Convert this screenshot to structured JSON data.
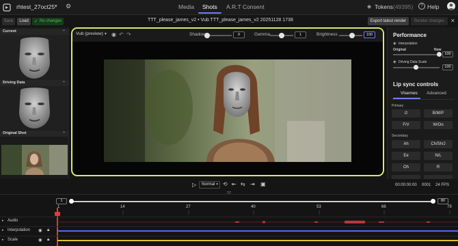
{
  "header": {
    "project_name": "rhtest_27oct25",
    "nav_tabs": [
      "Media",
      "Shots",
      "A.R.T Consent"
    ],
    "active_tab": "Shots",
    "tokens_label": "Tokens",
    "tokens_count": "(49395)",
    "help_label": "Help"
  },
  "toolbar": {
    "save_label": "Save",
    "load_label": "Load",
    "no_changes_label": "No changes",
    "shot_title": "TTT_please_james_v2 • Vub TTT_please_james_v2 20251128 1738",
    "export_label": "Export latest render",
    "render_changes_label": "Render changes"
  },
  "left_panel": {
    "sections": [
      "Current",
      "Driving Data",
      "Original Shot"
    ]
  },
  "viewer": {
    "preview_select": "Vub (preview)",
    "shadows_label": "Shadows",
    "shadows_value": "0",
    "gamma_label": "Gamma",
    "gamma_value": "1",
    "brightness_label": "Brightness",
    "brightness_value": "100",
    "shadows_level": 0.0,
    "gamma_level": 0.5,
    "brightness_level": 0.55
  },
  "performance": {
    "title": "Performance",
    "interpolation_label": "Interpolation",
    "original_label": "Original",
    "now_label": "Now",
    "interpolation_value": "100",
    "interpolation_level": 1.0,
    "driving_scale_label": "Driving Data Scale",
    "driving_scale_value": "100",
    "driving_scale_level": 0.5
  },
  "lip_sync": {
    "title": "Lip sync controls",
    "tabs": [
      "Visemes",
      "Advanced"
    ],
    "active_tab": "Visemes",
    "primary_label": "Primary",
    "primary_buttons": [
      "∅",
      "B/M/P",
      "F/V",
      "W/Oo"
    ],
    "secondary_label": "Secondary",
    "secondary_buttons": [
      "Ah",
      "Ch/Sh/J",
      "Ee",
      "N/L",
      "Oh",
      "R"
    ]
  },
  "transport": {
    "speed": "Normal",
    "timecode": "00:00:00:00",
    "frame": "0001",
    "fps": "24 FPS"
  },
  "timeline": {
    "range_start": "1",
    "range_end": "80",
    "ticks": [
      "1",
      "14",
      "27",
      "40",
      "53",
      "66",
      "79"
    ],
    "tracks": [
      "Audio",
      "Interpolation",
      "Scale"
    ]
  },
  "colors": {
    "accent": "#6f7cff",
    "viewer_border": "#d9ea6e",
    "no_changes_green": "#4fbf5a",
    "playhead_red": "#e23a3a",
    "interp_line": "#4b6cff",
    "scale_line": "#e0c02a"
  },
  "icons": [
    "home-icon",
    "settings-icon",
    "tokens-icon",
    "help-icon",
    "avatar",
    "camera-icon",
    "undo-icon",
    "redo-icon",
    "close-icon",
    "play-icon",
    "loop-icon",
    "step-back-icon",
    "step-forward-icon",
    "snapshot-icon",
    "lock-icon",
    "eye-icon"
  ]
}
